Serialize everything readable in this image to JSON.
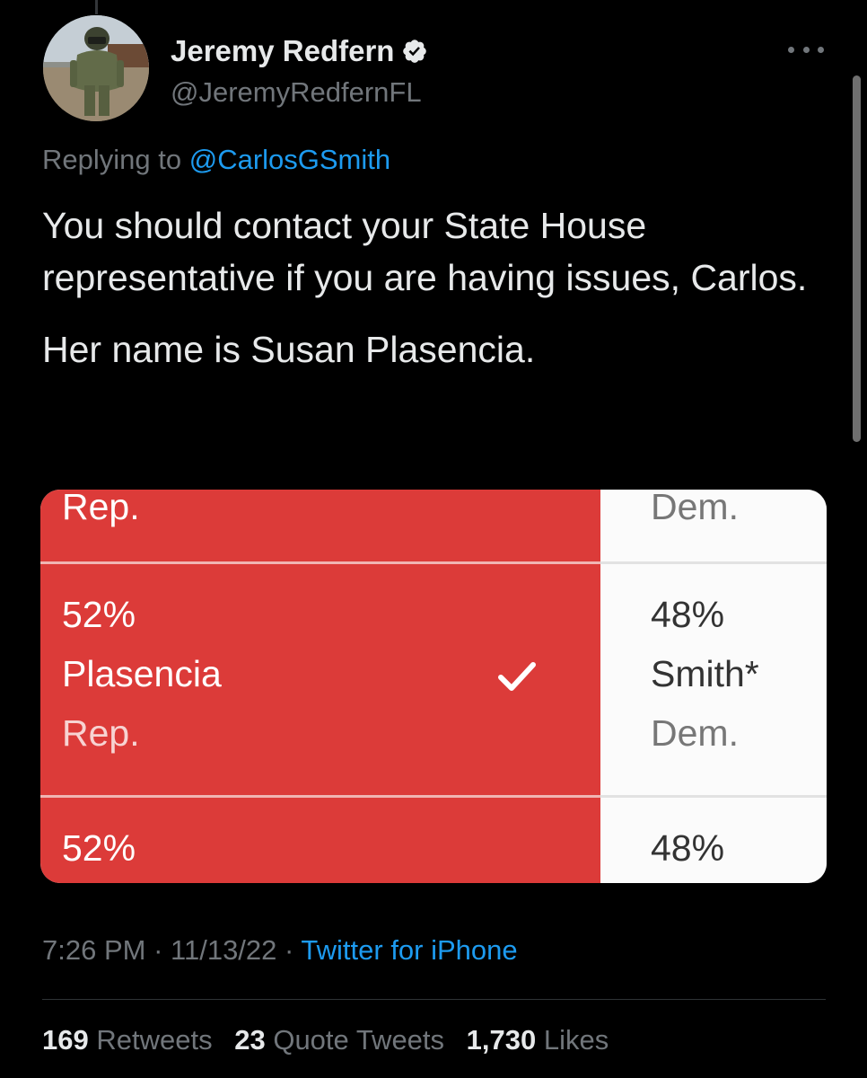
{
  "author": {
    "name": "Jeremy Redfern",
    "handle": "@JeremyRedfernFL",
    "verified": true
  },
  "reply": {
    "prefix": "Replying to",
    "mention": "@CarlosGSmith"
  },
  "tweet": {
    "paragraphs": [
      "You should contact your State House representative if you are having issues, Carlos.",
      "Her name is Susan Plasencia."
    ]
  },
  "media": {
    "top_left": "Rep.",
    "top_right": "Dem.",
    "rep_pct": "52%",
    "rep_name": "Plasencia",
    "rep_party": "Rep.",
    "dem_pct": "48%",
    "dem_name": "Smith*",
    "dem_party": "Dem.",
    "bottom_left": "52%",
    "bottom_right": "48%"
  },
  "meta": {
    "time": "7:26 PM",
    "date": "11/13/22",
    "source": "Twitter for iPhone"
  },
  "stats": {
    "retweets_count": "169",
    "retweets_label": "Retweets",
    "quotes_count": "23",
    "quotes_label": "Quote Tweets",
    "likes_count": "1,730",
    "likes_label": "Likes"
  },
  "colors": {
    "background": "#000000",
    "link": "#1d9bf0",
    "muted": "#71767b",
    "rep_red": "#dc3b39"
  },
  "icons": {
    "verified": "verified-badge-icon",
    "more": "more-icon",
    "check": "checkmark-icon"
  }
}
